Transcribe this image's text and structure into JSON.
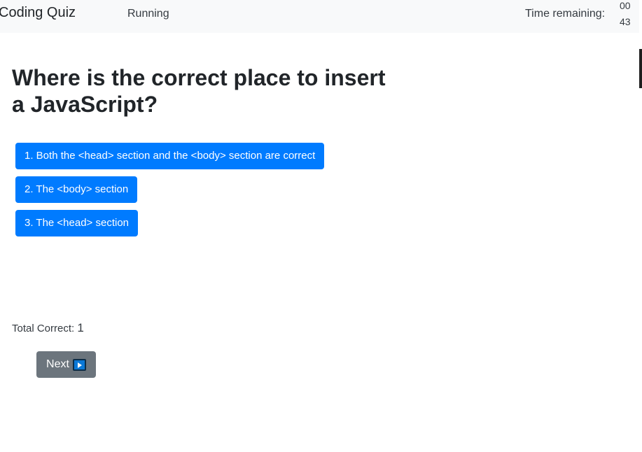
{
  "navbar": {
    "brand": "Coding Quiz",
    "status": "Running",
    "time_label": "Time remaining:",
    "time_minutes": "00",
    "time_seconds": "43"
  },
  "question": {
    "text": "Where is the correct place to insert a JavaScript?"
  },
  "answers": [
    "1. Both the <head> section and the <body> section are correct",
    "2. The <body> section",
    "3. The <head> section"
  ],
  "score": {
    "label": "Total Correct:",
    "value": "1"
  },
  "next_button": {
    "label": "Next",
    "icon": "play-icon"
  },
  "colors": {
    "answer_button": "#007bff",
    "next_button": "#6c757d",
    "navbar_bg": "#f8f9fa"
  }
}
